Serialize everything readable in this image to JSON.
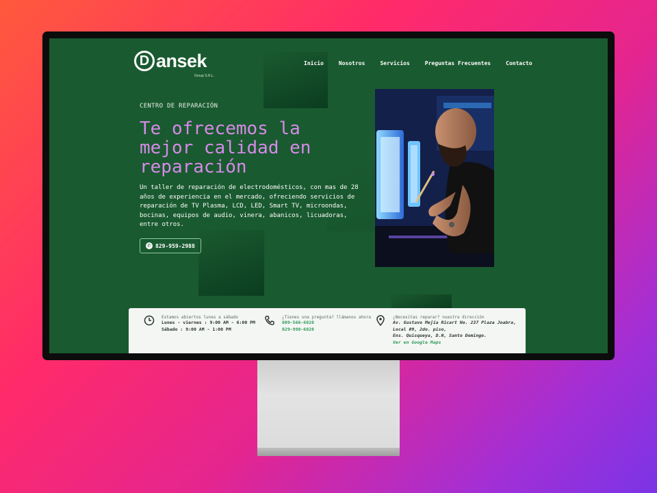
{
  "brand": {
    "logo_letter": "D",
    "logo_rest": "ansek",
    "logo_sub": "Group S.R.L."
  },
  "nav": [
    "Inicio",
    "Nosotros",
    "Servicios",
    "Preguntas Frecuentes",
    "Contacto"
  ],
  "hero": {
    "eyebrow": "CENTRO DE REPARACIÓN",
    "headline": "Te ofrecemos la mejor calidad en reparación",
    "description": "Un taller de reparación de electrodomésticos, con mas de 28 años de experiencia en el mercado, ofreciendo servicios de reparación de TV Plasma, LCD, LED, Smart TV, microondas, bocinas, equipos de audio, vinera, abanicos, licuadoras, entre otros.",
    "phone_button": "829-959-2988"
  },
  "info": {
    "hours": {
      "title": "Estamos abiertos lunes a sábado",
      "line1": "Lunes - viernes : 9:00 AM - 6:00 PM",
      "line2": "Sábado : 9:00 AM - 1:00 PM"
    },
    "contact": {
      "title": "¿Tienes una pregunta? llámanos ahora",
      "phone1": "809-566-6828",
      "phone2": "829-998-6828"
    },
    "address": {
      "title": "¿Necesitas reparar? nuestra dirección",
      "line1": "Av. Gustavo Mejía Ricart No. 237 Plaza Joabra,",
      "line2": "Local #9, 2do. piso,",
      "line3": "Ens. Quisqueya, D.N, Santo Domingo.",
      "link": "Ver en Google Maps"
    }
  },
  "colors": {
    "screen_bg": "#1a5a30",
    "headline": "#d68ae8",
    "accent_green": "#2b9a58"
  },
  "icons": [
    "clock-icon",
    "phone-icon",
    "map-pin-icon",
    "whatsapp-icon"
  ]
}
